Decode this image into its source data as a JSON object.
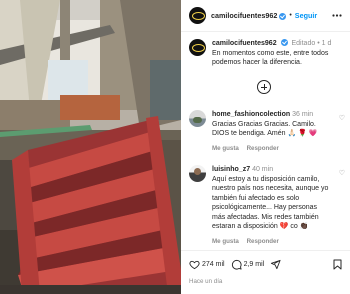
{
  "post": {
    "author": "camilocifuentes962",
    "follow_label": "Seguir",
    "separator": "•",
    "caption_author": "camilocifuentes962",
    "edited_label": "Editado",
    "caption_time": "1 d",
    "caption_text": "En momentos como este, entre todos podemos hacer la diferencia.",
    "time_ago": "Hace un día"
  },
  "comments": [
    {
      "username": "home_fashioncolection",
      "time": "36 min",
      "text": "Gracias Gracias Gracias. Camilo. DIOS te bendiga. Amén 🙏🏻 🌹 💗",
      "likes_label": "Me gusta",
      "reply_label": "Responder"
    },
    {
      "username": "luisinho_z7",
      "time": "40 min",
      "text": "Aquí estoy a tu disposición camilo, nuestro país nos necesita, aunque yo también fui afectado es solo psicológicamente... Hay personas más afectadas. Mis redes también estaran a disposición 💔 co 👏🏿",
      "likes_label": "Me gusta",
      "reply_label": "Responder"
    }
  ],
  "stats": {
    "likes": "274 mil",
    "comments": "2,9 mil"
  },
  "icons": [
    "verified-icon",
    "more-options-icon",
    "add-comment-icon",
    "heart-icon",
    "comment-icon",
    "share-icon",
    "bookmark-icon"
  ],
  "colors": {
    "accent": "#0095f6",
    "verified": "#3897f0",
    "stairs": "#b8413f"
  }
}
